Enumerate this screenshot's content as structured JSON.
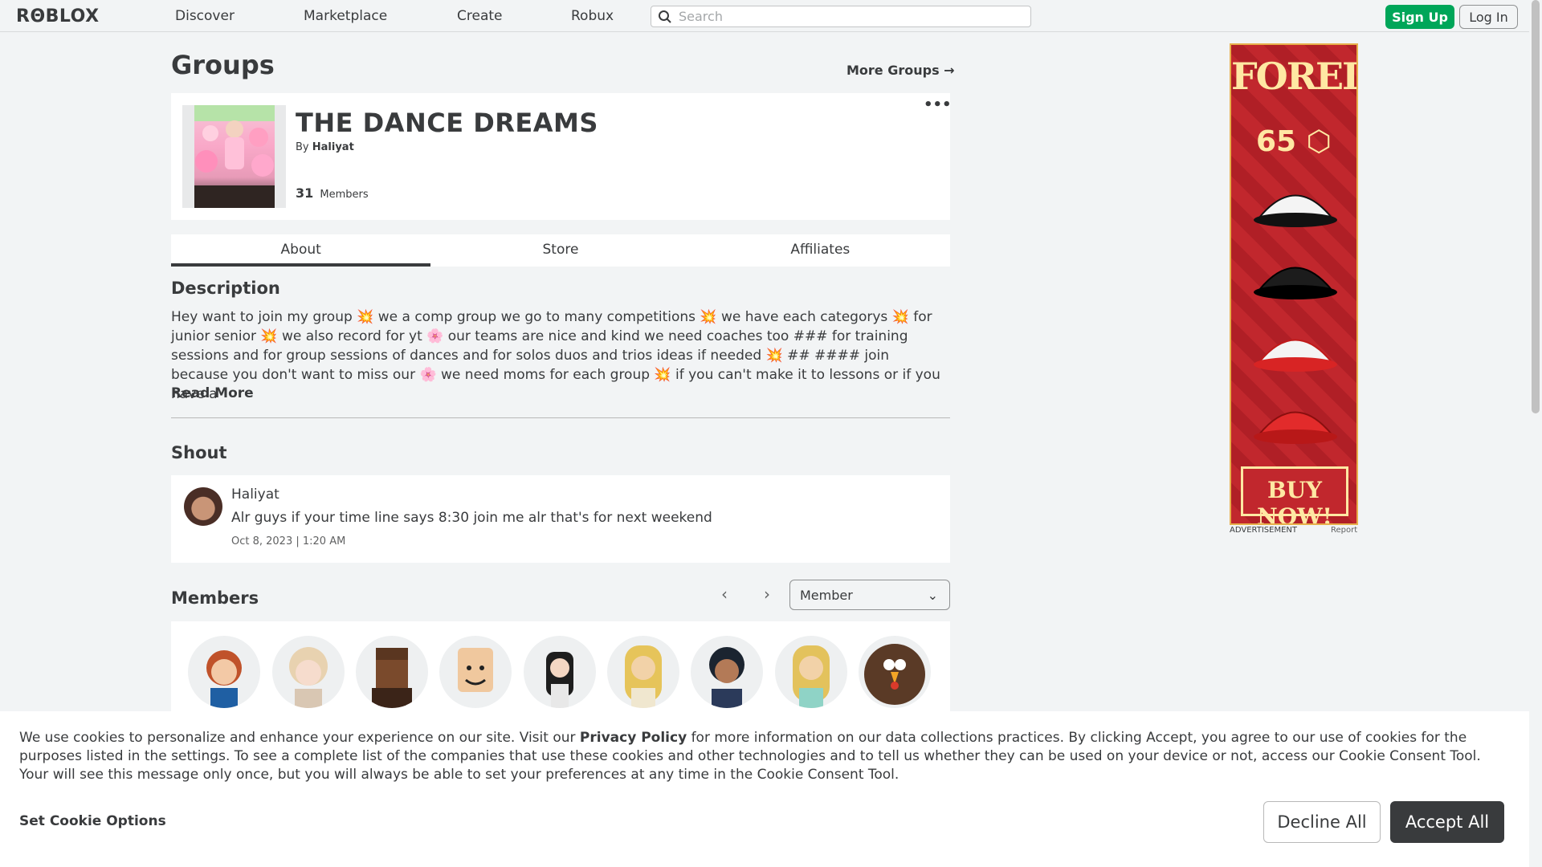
{
  "nav": {
    "logo": "RΘBLOX",
    "links": [
      "Discover",
      "Marketplace",
      "Create",
      "Robux"
    ],
    "search_placeholder": "Search",
    "signup": "Sign Up",
    "login": "Log In"
  },
  "page": {
    "title": "Groups",
    "more_groups": "More Groups →"
  },
  "group": {
    "name": "THE DANCE DREAMS",
    "by_prefix": "By",
    "owner": "Haliyat",
    "member_count": "31",
    "members_label": "Members",
    "menu": "•••"
  },
  "tabs": [
    "About",
    "Store",
    "Affiliates"
  ],
  "about": {
    "description_heading": "Description",
    "description": "Hey want to join my group 💥 we a comp group we go to many competitions 💥 we have each categorys 💥 for junior senior 💥 we also record for yt 🌸 our teams are nice and kind we need coaches too ### for training sessions and for group sessions of dances and for solos duos and trios ideas if needed 💥 ## #### join because you don't want to miss our 🌸 we need moms for each group 💥 if you can't make it to lessons or if you have a",
    "read_more": "Read More",
    "shout_heading": "Shout",
    "shout": {
      "user": "Haliyat",
      "text": "Alr guys if your time line says 8:30 join me alr that's for next weekend",
      "date": "Oct 8, 2023 | 1:20 AM"
    },
    "members_heading": "Members",
    "role_select": "Member"
  },
  "ad": {
    "title": "FOREIGN",
    "price": "65",
    "buy": "BUY NOW!",
    "label": "ADVERTISEMENT",
    "report": "Report"
  },
  "cookie": {
    "text_before": "We use cookies to personalize and enhance your experience on our site. Visit our ",
    "policy_link": "Privacy Policy",
    "text_after": " for more information on our data collections practices. By clicking Accept, you agree to our use of cookies for the purposes listed in the settings. To see a complete list of the companies that use these cookies and other technologies and to tell us whether they can be used on your device or not, access our Cookie Consent Tool. Your will see this message only once, but you will always be able to set your preferences at any time in the Cookie Consent Tool.",
    "set_options": "Set Cookie Options",
    "decline": "Decline All",
    "accept": "Accept All"
  },
  "colors": {
    "accent_green": "#00a659",
    "text_dark": "#393b3d",
    "background": "#f2f4f5",
    "ad_red": "#c1272d"
  }
}
